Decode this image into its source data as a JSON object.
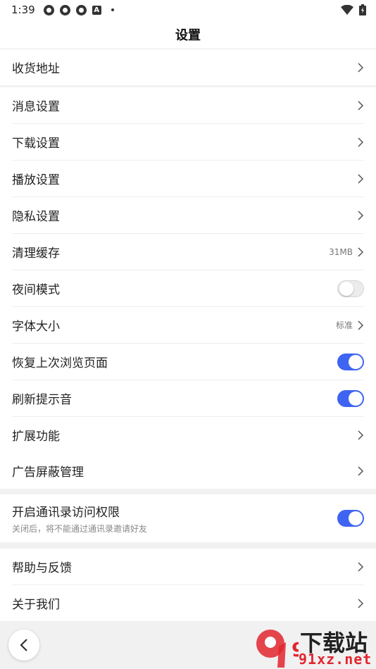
{
  "status_bar": {
    "time": "1:39"
  },
  "header": {
    "title": "设置"
  },
  "groups": [
    {
      "items": [
        {
          "label": "收货地址"
        }
      ]
    },
    {
      "items": [
        {
          "label": "消息设置"
        },
        {
          "label": "下载设置"
        },
        {
          "label": "播放设置"
        },
        {
          "label": "隐私设置"
        },
        {
          "label": "清理缓存",
          "value": "31MB"
        },
        {
          "label": "夜间模式",
          "toggle": false
        },
        {
          "label": "字体大小",
          "value": "标准"
        },
        {
          "label": "恢复上次浏览页面",
          "toggle": true
        },
        {
          "label": "刷新提示音",
          "toggle": true
        },
        {
          "label": "扩展功能"
        }
      ]
    },
    {
      "items": [
        {
          "label": "广告屏蔽管理"
        }
      ]
    },
    {
      "items": [
        {
          "label": "开启通讯录访问权限",
          "sublabel": "关闭后，将不能通过通讯录邀请好友",
          "toggle": true
        }
      ]
    },
    {
      "items": [
        {
          "label": "帮助与反馈"
        },
        {
          "label": "关于我们"
        }
      ]
    }
  ],
  "watermark": {
    "line1": "下载站",
    "line2": "91xz.net",
    "logo_text": "9"
  },
  "colors": {
    "toggle_on": "#3f64f2",
    "watermark_red": "#e2262f"
  }
}
